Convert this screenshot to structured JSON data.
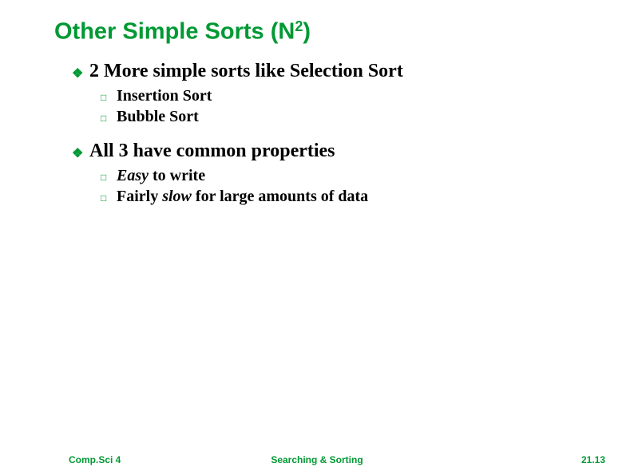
{
  "title": {
    "pre": "Other Simple Sorts (N",
    "sup": "2",
    "post": ")"
  },
  "bullets": [
    {
      "text": "2 More simple sorts like Selection Sort",
      "sub": [
        {
          "plain": "Insertion Sort"
        },
        {
          "plain": "Bubble Sort"
        }
      ]
    },
    {
      "text": "All 3 have common properties",
      "sub": [
        {
          "html": "<span class=\"easy\">Easy</span> to write"
        },
        {
          "html": "Fairly <span class=\"slow\">slow</span> for large amounts of data"
        }
      ]
    }
  ],
  "footer": {
    "left": "Comp.Sci 4",
    "center": "Searching & Sorting",
    "right": "21.13"
  },
  "glyphs": {
    "l1": "❖",
    "l2": "□"
  }
}
